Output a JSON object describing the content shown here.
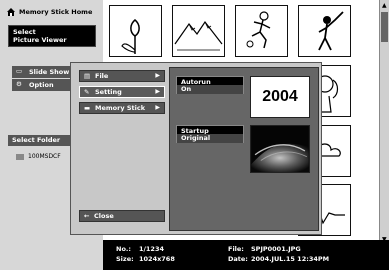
{
  "left_panel": {
    "home_label": "Memory Stick Home",
    "select_title": "Select",
    "select_value": "Picture Viewer",
    "slide_show_label": "Slide Show",
    "option_label": "Option",
    "select_folder_label": "Select Folder",
    "folder_name": "100MSDCF"
  },
  "dialog": {
    "menu": [
      {
        "label": "File",
        "icon": "file-icon"
      },
      {
        "label": "Setting",
        "icon": "wrench-icon"
      },
      {
        "label": "Memory Stick",
        "icon": "memory-stick-icon"
      }
    ],
    "close_label": "Close",
    "autorun_label": "Autorun",
    "autorun_value": "On",
    "year_text": "2004",
    "startup_label": "Startup",
    "startup_value": "Original"
  },
  "info": {
    "no_label": "No.:",
    "no_value": "1/1234",
    "size_label": "Size:",
    "size_value": "1024x768",
    "file_label": "File:",
    "file_value": "SPJP0001.JPG",
    "date_label": "Date:",
    "date_value": "2004.JUL.15 12:34PM"
  }
}
